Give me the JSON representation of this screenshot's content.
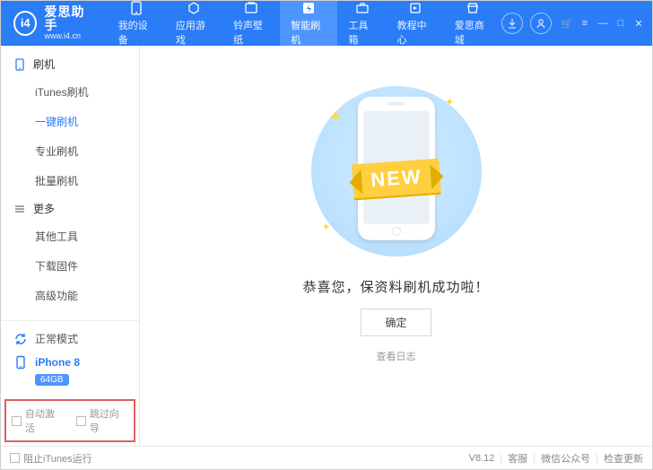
{
  "brand": {
    "name": "爱思助手",
    "url": "www.i4.cn",
    "logo_text": "i4"
  },
  "win_controls": {
    "cart": "🛒",
    "menu": "≡",
    "min": "—",
    "max": "□",
    "close": "✕"
  },
  "tabs": [
    {
      "icon": "phone",
      "label": "我的设备"
    },
    {
      "icon": "apps",
      "label": "应用游戏"
    },
    {
      "icon": "ring",
      "label": "铃声壁纸"
    },
    {
      "icon": "flash",
      "label": "智能刷机",
      "active": true
    },
    {
      "icon": "tools",
      "label": "工具箱"
    },
    {
      "icon": "tutor",
      "label": "教程中心"
    },
    {
      "icon": "store",
      "label": "爱思商城"
    }
  ],
  "sidebar": {
    "groups": [
      {
        "title": "刷机",
        "icon": "phone-outline",
        "items": [
          "iTunes刷机",
          "一键刷机",
          "专业刷机",
          "批量刷机"
        ],
        "active_index": 1
      },
      {
        "title": "更多",
        "icon": "menu-lines",
        "items": [
          "其他工具",
          "下载固件",
          "高级功能"
        ]
      }
    ]
  },
  "status": {
    "mode_label": "正常模式",
    "device_name": "iPhone 8",
    "storage_badge": "64GB"
  },
  "highlight_options": {
    "opt1": "自动激活",
    "opt2": "跳过向导"
  },
  "main": {
    "ribbon": "NEW",
    "success": "恭喜您，保资料刷机成功啦！",
    "ok": "确定",
    "view_log": "查看日志"
  },
  "footer": {
    "block_itunes": "阻止iTunes运行",
    "version": "V8.12",
    "links": [
      "客服",
      "微信公众号",
      "检查更新"
    ]
  }
}
